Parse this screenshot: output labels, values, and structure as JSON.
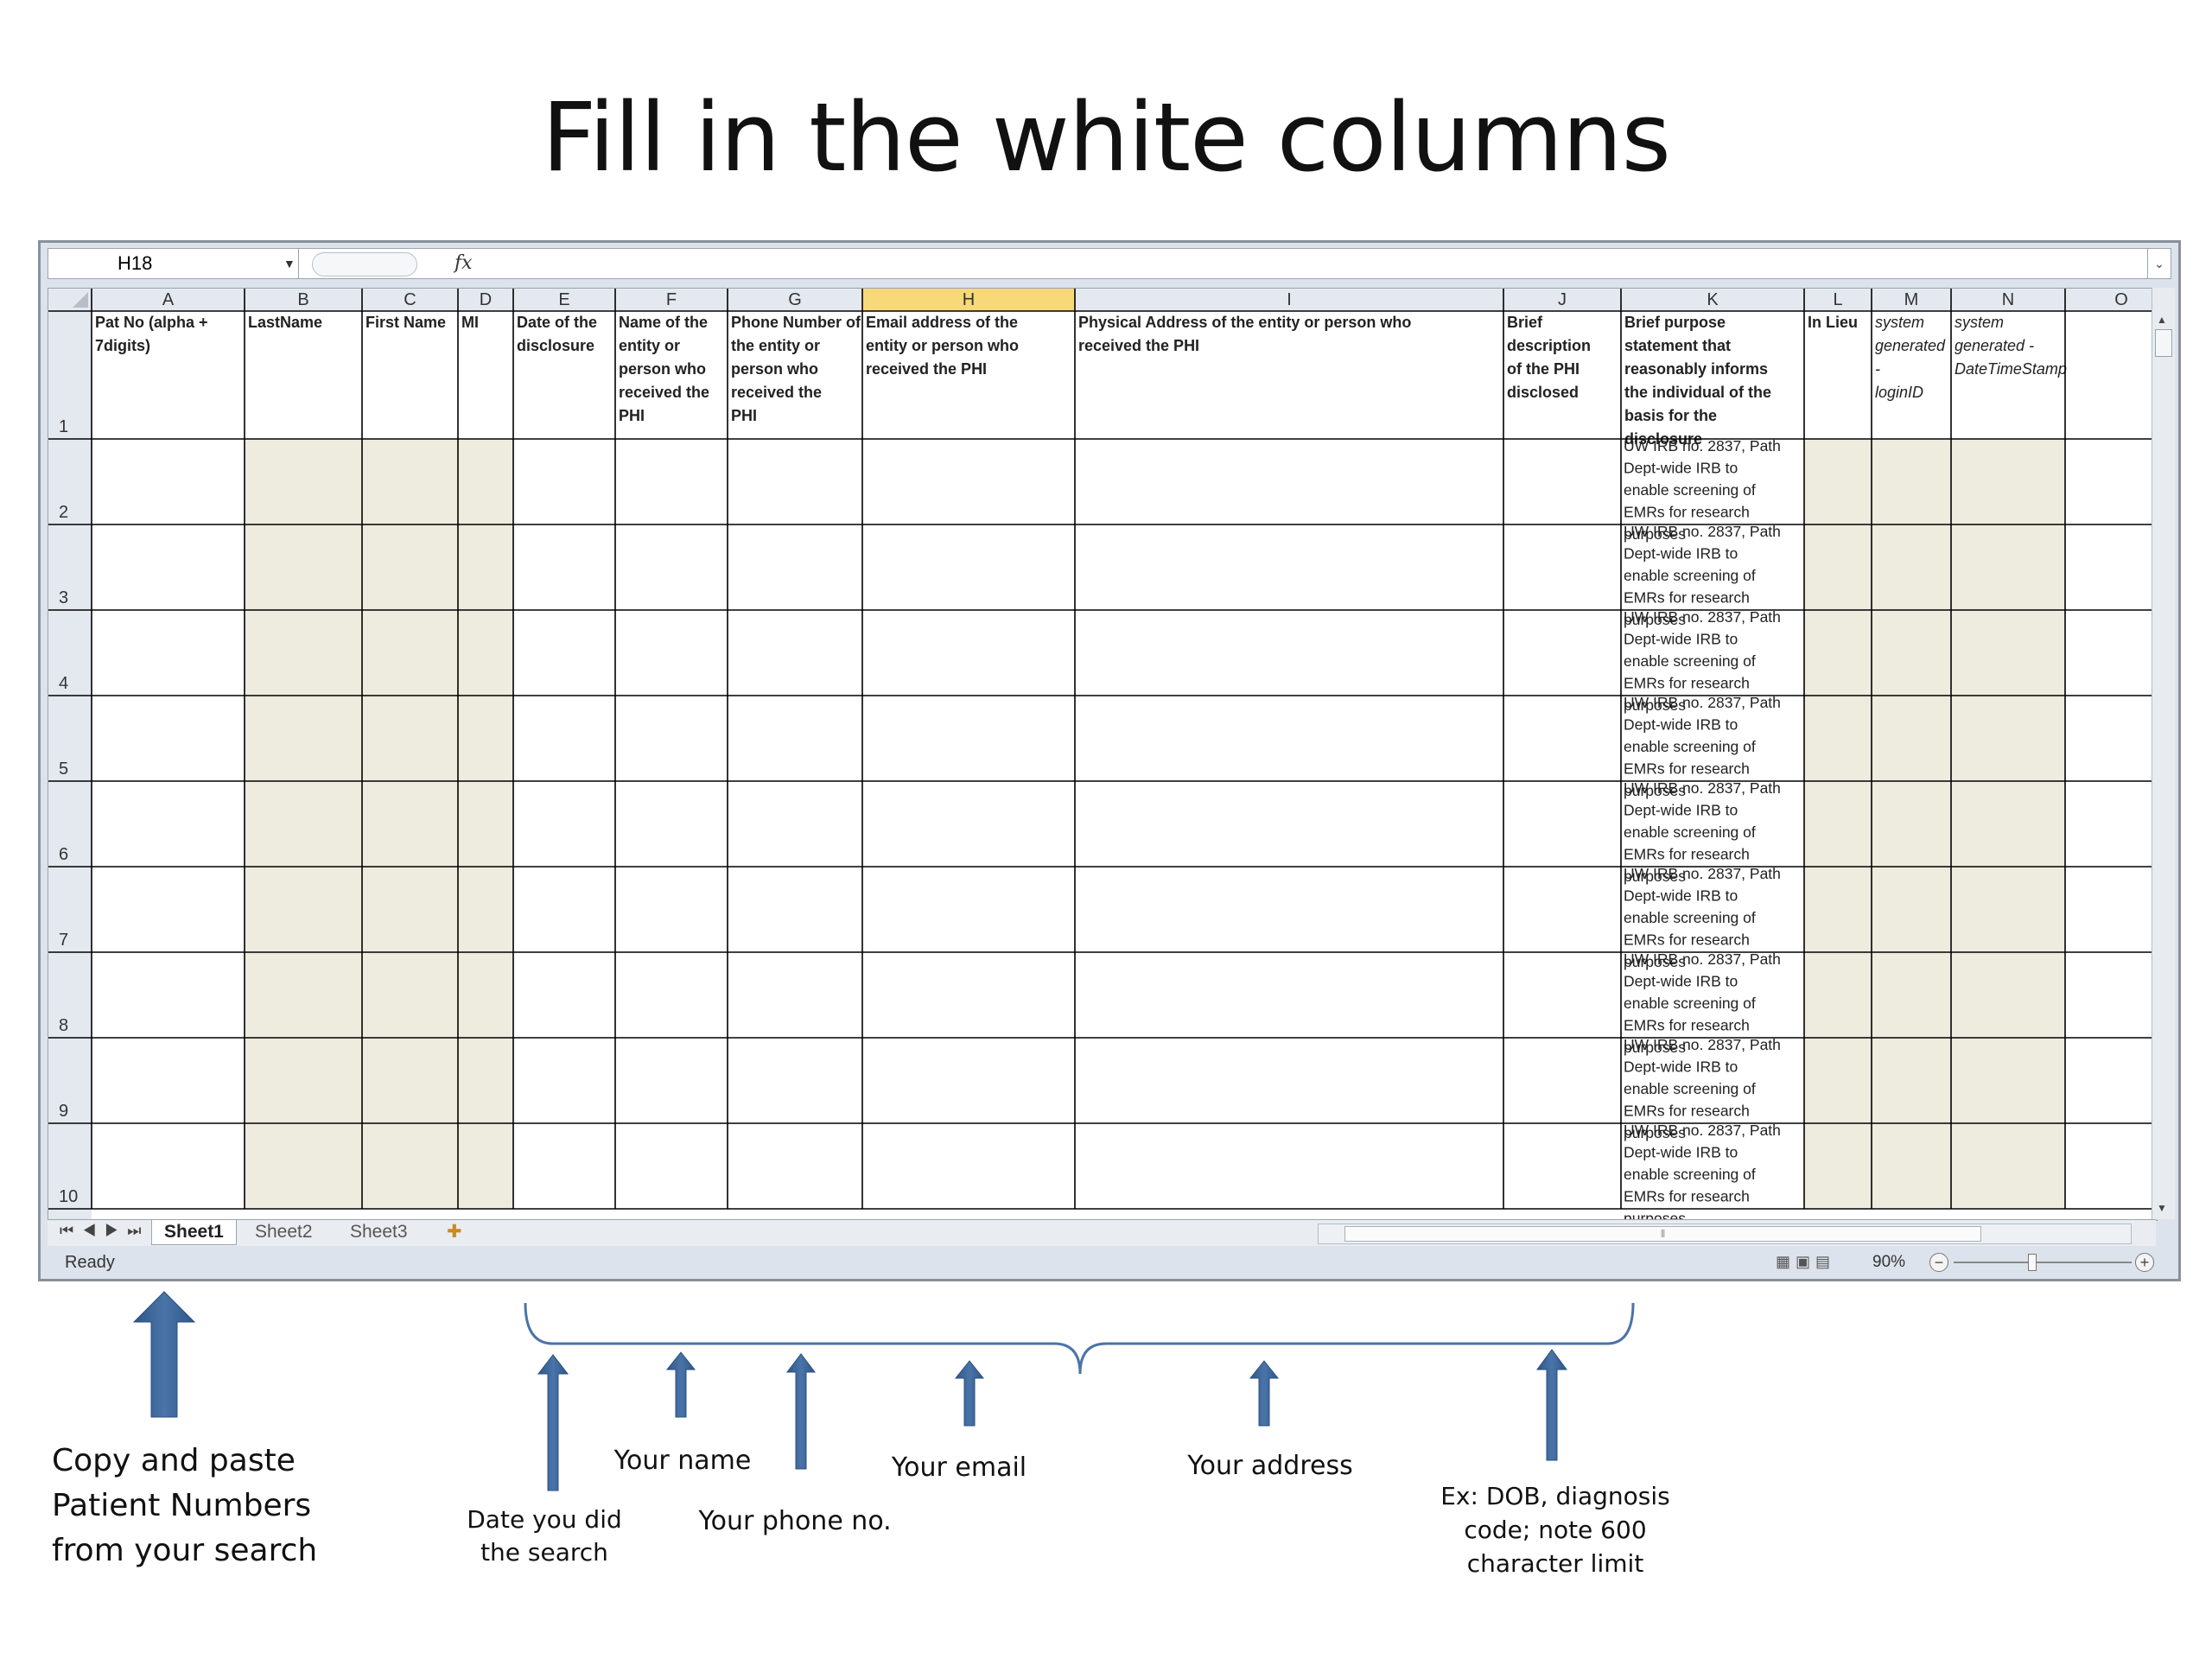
{
  "slide_title": "Fill in the white columns",
  "formula_bar": {
    "name_box": "H18",
    "fx": "fx"
  },
  "columns": [
    {
      "letter": "A",
      "header": "Pat No (alpha + 7digits)",
      "shade": false
    },
    {
      "letter": "B",
      "header": "LastName",
      "shade": true
    },
    {
      "letter": "C",
      "header": "First Name",
      "shade": true
    },
    {
      "letter": "D",
      "header": "MI",
      "shade": true
    },
    {
      "letter": "E",
      "header": "Date of the disclosure",
      "shade": false
    },
    {
      "letter": "F",
      "header": "Name of the entity or person who received the PHI",
      "shade": false
    },
    {
      "letter": "G",
      "header": "Phone Number of the entity or person who received the PHI",
      "shade": false
    },
    {
      "letter": "H",
      "header": "Email address of the entity or person who received the PHI",
      "shade": false,
      "selected": true
    },
    {
      "letter": "I",
      "header": "Physical Address of the entity or person who received the PHI",
      "shade": false
    },
    {
      "letter": "J",
      "header": "Brief description of the PHI disclosed",
      "shade": false
    },
    {
      "letter": "K",
      "header": "Brief purpose statement that reasonably informs the individual of the basis for the disclosure",
      "shade": false
    },
    {
      "letter": "L",
      "header": "In Lieu",
      "shade": true
    },
    {
      "letter": "M",
      "header": "system generated - loginID",
      "shade": true,
      "italic": true
    },
    {
      "letter": "N",
      "header": "system generated - DateTimeStamp",
      "shade": true,
      "italic": true
    },
    {
      "letter": "O",
      "header": "",
      "shade": false
    }
  ],
  "row_numbers": [
    "1",
    "2",
    "3",
    "4",
    "5",
    "6",
    "7",
    "8",
    "9",
    "10"
  ],
  "purpose_text": "UW IRB no. 2837, Path Dept-wide IRB to enable screening of EMRs for research purposes",
  "sheet_tabs": [
    "Sheet1",
    "Sheet2",
    "Sheet3"
  ],
  "status": {
    "ready": "Ready",
    "zoom": "90%"
  },
  "annotations": {
    "copy_paste": "Copy and paste Patient Numbers from your search",
    "date": "Date you did the search",
    "name": "Your name",
    "phone": "Your phone no.",
    "email": "Your email",
    "address": "Your address",
    "example": "Ex:  DOB, diagnosis code; note  600 character limit"
  },
  "colors": {
    "shaded_cell": "#eeebdf",
    "arrow": "#3b6294",
    "selected_header": "#f7d97a"
  }
}
